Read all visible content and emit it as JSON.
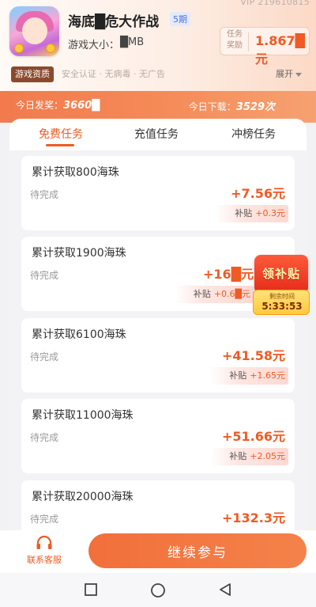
{
  "header": {
    "vip_id": "VIP 219610815",
    "game_title": "海底█危大作战",
    "period_badge": "5期",
    "size_label": "游戏大小：",
    "size_value": "█MB",
    "reward_label": "任务奖励",
    "reward_value": "1.867█元"
  },
  "qualification": {
    "tag": "游戏资质",
    "items": "安全认证 · 无病毒 · 无广告",
    "expand_label": "展开"
  },
  "stats": {
    "left": "今日发奖：",
    "left_value": "3660█",
    "right": "今日下载：",
    "right_value": "3529次"
  },
  "tabs": [
    {
      "label": "免费任务",
      "active": true
    },
    {
      "label": "充值任务",
      "active": false
    },
    {
      "label": "冲榜任务",
      "active": false
    }
  ],
  "tasks": [
    {
      "title": "累计获取800海珠",
      "status": "待完成",
      "reward": "+7.56元",
      "subsidy_label": "补贴",
      "subsidy_value": "+0.3元"
    },
    {
      "title": "累计获取1900海珠",
      "status": "待完成",
      "reward": "+16█元",
      "subsidy_label": "补贴",
      "subsidy_value": "+0.6█元"
    },
    {
      "title": "累计获取6100海珠",
      "status": "待完成",
      "reward": "+41.58元",
      "subsidy_label": "补贴",
      "subsidy_value": "+1.65元"
    },
    {
      "title": "累计获取11000海珠",
      "status": "待完成",
      "reward": "+51.66元",
      "subsidy_label": "补贴",
      "subsidy_value": "+2.05元"
    },
    {
      "title": "累计获取20000海珠",
      "status": "待完成",
      "reward": "+132.3元"
    }
  ],
  "promo": {
    "title": "领补贴",
    "timer_label": "剩余时间",
    "timer": "5:33:53"
  },
  "bottom": {
    "service_label": "联系客服",
    "continue_label": "继续参与"
  },
  "colors": {
    "accent": "#f05a24",
    "stats_bar": "#f27a4c",
    "button": "#f4824a"
  }
}
